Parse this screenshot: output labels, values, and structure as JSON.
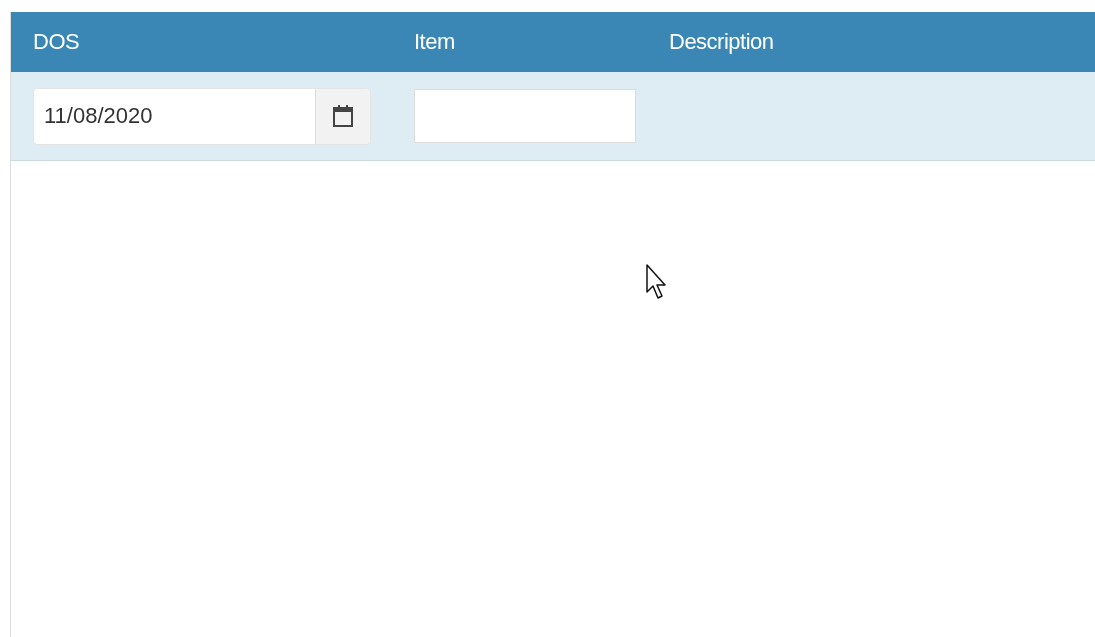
{
  "table": {
    "columns": [
      {
        "label": "DOS"
      },
      {
        "label": "Item"
      },
      {
        "label": "Description"
      }
    ],
    "filters": [
      {
        "kind": "date",
        "value": "11/08/2020"
      },
      {
        "kind": "text"
      }
    ]
  }
}
